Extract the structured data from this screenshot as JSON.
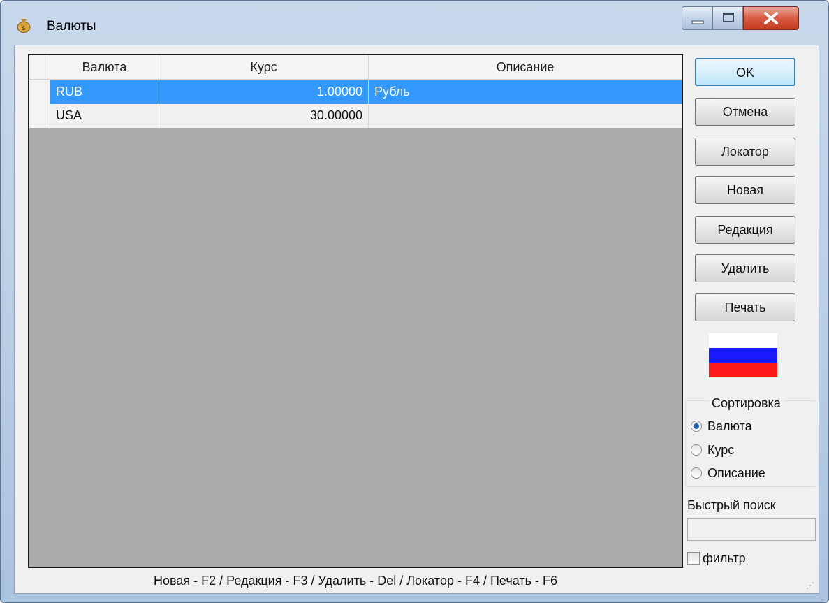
{
  "window": {
    "title": "Валюты",
    "icon": "money-bag-icon",
    "controls": [
      "minimize-icon",
      "maximize-icon",
      "close-icon"
    ]
  },
  "grid": {
    "columns": [
      "Валюта",
      "Курс",
      "Описание"
    ],
    "rows": [
      {
        "currency": "RUB",
        "rate": "1.00000",
        "description": "Рубль",
        "selected": true
      },
      {
        "currency": "USA",
        "rate": "30.00000",
        "description": "",
        "selected": false
      }
    ]
  },
  "buttons": {
    "ok": "OK",
    "cancel": "Отмена",
    "locator": "Локатор",
    "new": "Новая",
    "edit": "Редакция",
    "delete": "Удалить",
    "print": "Печать"
  },
  "flag": {
    "colors": [
      "#ffffff",
      "#1a1aff",
      "#ff1a1a"
    ]
  },
  "sort": {
    "title": "Сортировка",
    "options": [
      "Валюта",
      "Курс",
      "Описание"
    ],
    "selected": "Валюта"
  },
  "quick_search": {
    "label": "Быстрый поиск",
    "value": ""
  },
  "filter": {
    "label": "фильтр",
    "checked": false
  },
  "hint": "Новая - F2 / Редакция - F3 / Удалить - Del / Локатор - F4 / Печать - F6",
  "colors": {
    "selection": "#3399ff",
    "grid_background": "#ababab"
  }
}
